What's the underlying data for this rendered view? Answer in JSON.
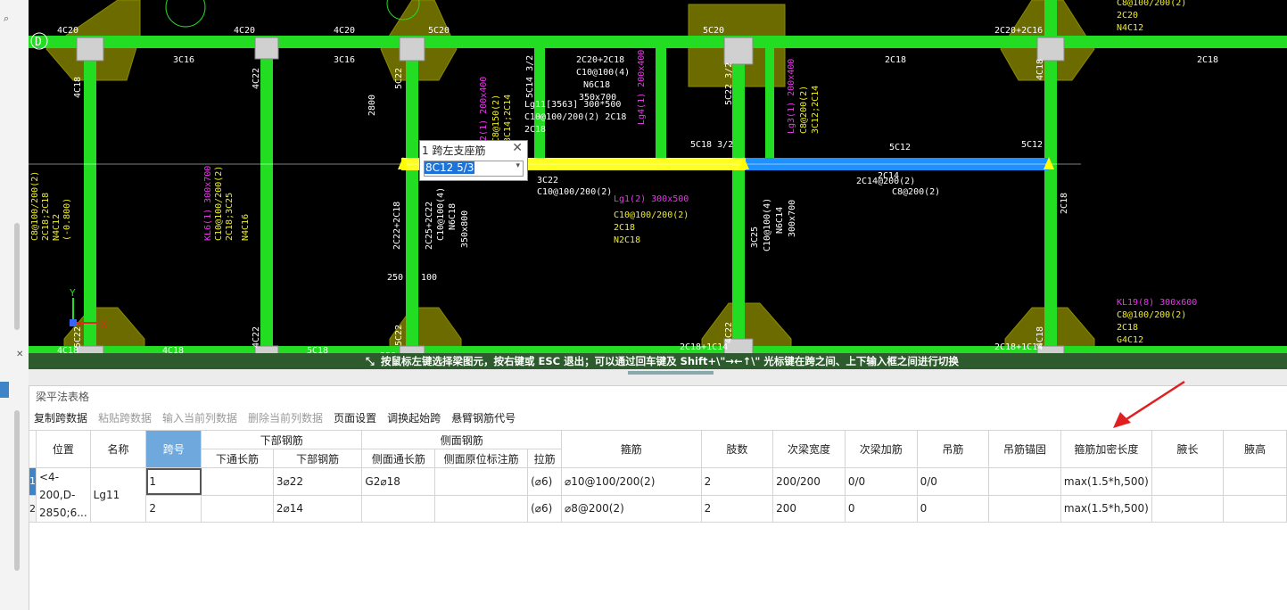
{
  "status_hint": "按鼠标左键选择梁图元，按右键或 ESC 退出；可以通过回车键及 Shift+\\\"→←↑\\\" 光标键在跨之间、上下输入框之间进行切换",
  "popup": {
    "title": "1 跨左支座筋",
    "value": "8C12 5/3"
  },
  "panel": {
    "title": "梁平法表格",
    "toolbar": [
      "复制跨数据",
      "粘贴跨数据",
      "输入当前列数据",
      "删除当前列数据",
      "页面设置",
      "调换起始跨",
      "悬臂钢筋代号"
    ]
  },
  "table": {
    "group_headers": {
      "bottom_rebar": "下部钢筋",
      "side_rebar": "侧面钢筋"
    },
    "headers": {
      "position": "位置",
      "name": "名称",
      "span": "跨号",
      "bottom_through": "下通长筋",
      "bottom": "下部钢筋",
      "side_through": "侧面通长筋",
      "side_orig": "侧面原位标注筋",
      "tie": "拉筋",
      "stirrup": "箍筋",
      "legs": "肢数",
      "sec_width": "次梁宽度",
      "sec_add": "次梁加筋",
      "hanger": "吊筋",
      "hanger_anchor": "吊筋锚固",
      "dense_len": "箍筋加密长度",
      "haunch_len": "腋长",
      "haunch_h": "腋高"
    },
    "position_text": "<4-200,D-2850;6...",
    "name_text": "Lg11",
    "rows": [
      {
        "num": "1",
        "span": "1",
        "bottom_through": "",
        "bottom": "3⌀22",
        "side_through": "G2⌀18",
        "side_orig": "",
        "tie": "(⌀6)",
        "stirrup": "⌀10@100/200(2)",
        "legs": "2",
        "sec_width": "200/200",
        "sec_add": "0/0",
        "hanger": "0/0",
        "hanger_anchor": "",
        "dense_len": "max(1.5*h,500)",
        "haunch_len": "",
        "haunch_h": ""
      },
      {
        "num": "2",
        "span": "2",
        "bottom_through": "",
        "bottom": "2⌀14",
        "side_through": "",
        "side_orig": "",
        "tie": "(⌀6)",
        "stirrup": "⌀8@200(2)",
        "legs": "2",
        "sec_width": "200",
        "sec_add": "0",
        "hanger": "0",
        "hanger_anchor": "",
        "dense_len": "max(1.5*h,500)",
        "haunch_len": "",
        "haunch_h": ""
      }
    ]
  },
  "cad": {
    "axis_labels": [
      "D",
      "C"
    ],
    "green_labels": [
      "4C20",
      "4C20",
      "4C20",
      "5C20",
      "5C20",
      "2C20+2C16",
      "3C16",
      "3C16",
      "2C18",
      "2C18",
      "2C18",
      "4C18",
      "4C22",
      "5C22",
      "5C14 3/2",
      "5C22 3/2",
      "4C18",
      "4C18",
      "5C18",
      "4C18",
      "4C22",
      "5C22",
      "4C22",
      "2C18+1C14",
      "4C18",
      "2C18+1C14"
    ],
    "white_labels": [
      "2C20+2C18",
      "C10@100(4)",
      "N6C18",
      "350x700",
      "Lg11[3563] 300*500",
      "C10@100/200(2) 2C18",
      "2C18",
      "3C22",
      "C10@100/200(2)",
      "5C18 3/2",
      "5C12",
      "5C12",
      "2800",
      "2C22+2C18",
      "2C25+2C22",
      "C10@100(4)",
      "N6C18",
      "350x800",
      "3C25",
      "C10@100(4)",
      "N6C14",
      "300x700",
      "250",
      "100",
      "2C14",
      "2C14@200(2)",
      "C8@200(2)",
      "C8@200(2)"
    ],
    "magenta_labels": [
      "Lg2(1) 200x400",
      "Lg4(1) 200x400",
      "Lg3(1) 200x400",
      "Lg1(2) 300x500",
      "KL6(1) 300x700",
      "KL19(8) 300x600"
    ],
    "yellow_labels": [
      "C8@150(2)",
      "3C14;2C14",
      "C8@200(2)",
      "3C12;2C14",
      "C10@100/200(2)",
      "2C18",
      "N2C18",
      "C10@100/200(2)",
      "2C18;3C25",
      "N4C16",
      "C8@100/200(2)",
      "2C18;2C18",
      "N4C12",
      "(-0.800)",
      "C8@100/200(2)",
      "2C20",
      "N4C12",
      "C8@100/200(2)",
      "2C18",
      "G4C12"
    ]
  }
}
